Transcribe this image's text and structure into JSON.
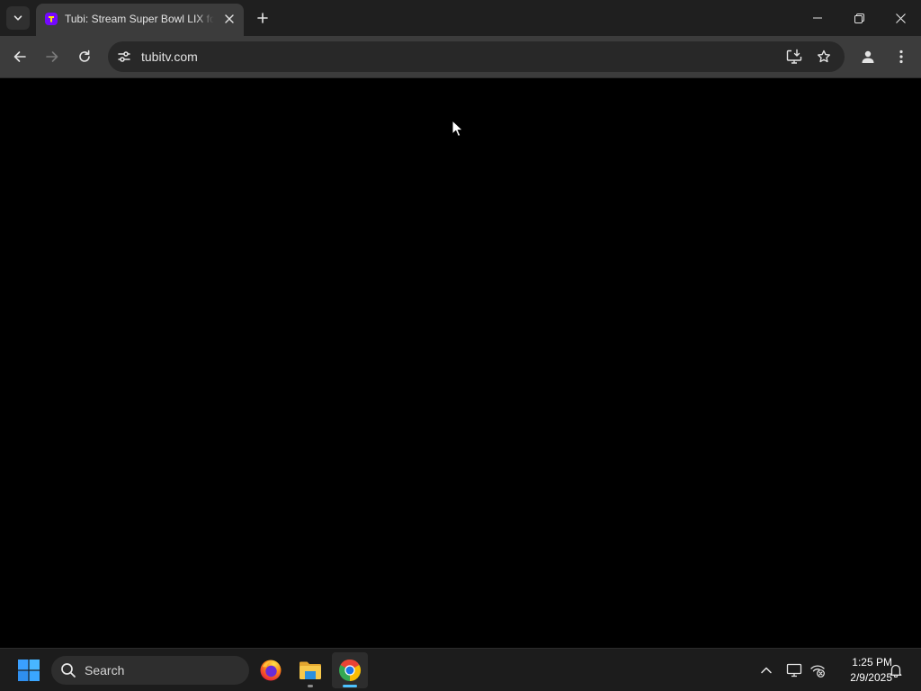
{
  "browser": {
    "tab": {
      "title": "Tubi: Stream Super Bowl LIX for Free",
      "favicon": "tubi-favicon-icon"
    },
    "address_bar": {
      "url": "tubitv.com"
    },
    "icons": {
      "tab_search": "chevron-down-icon",
      "new_tab": "plus-icon",
      "back": "arrow-left-icon",
      "forward": "arrow-right-icon",
      "reload": "reload-icon",
      "site_info": "tune-icon",
      "install": "install-app-icon",
      "bookmark": "star-icon",
      "profile": "person-icon",
      "menu": "kebab-menu-icon"
    }
  },
  "page": {
    "background": "#000000"
  },
  "taskbar": {
    "search_placeholder": "Search",
    "apps": [
      {
        "name": "Firefox",
        "icon": "firefox-icon"
      },
      {
        "name": "File Explorer",
        "icon": "folder-icon"
      },
      {
        "name": "Google Chrome",
        "icon": "chrome-icon"
      }
    ],
    "clock": {
      "time": "1:25 PM",
      "date": "2/9/2025"
    }
  },
  "colors": {
    "tab_active": "#3c3c3c",
    "tabstrip": "#1f1f1f",
    "omnibox": "#282828",
    "taskbar": "#1c1c1c",
    "accent": "#4cc2ff",
    "tubi_purple": "#7408ff"
  }
}
